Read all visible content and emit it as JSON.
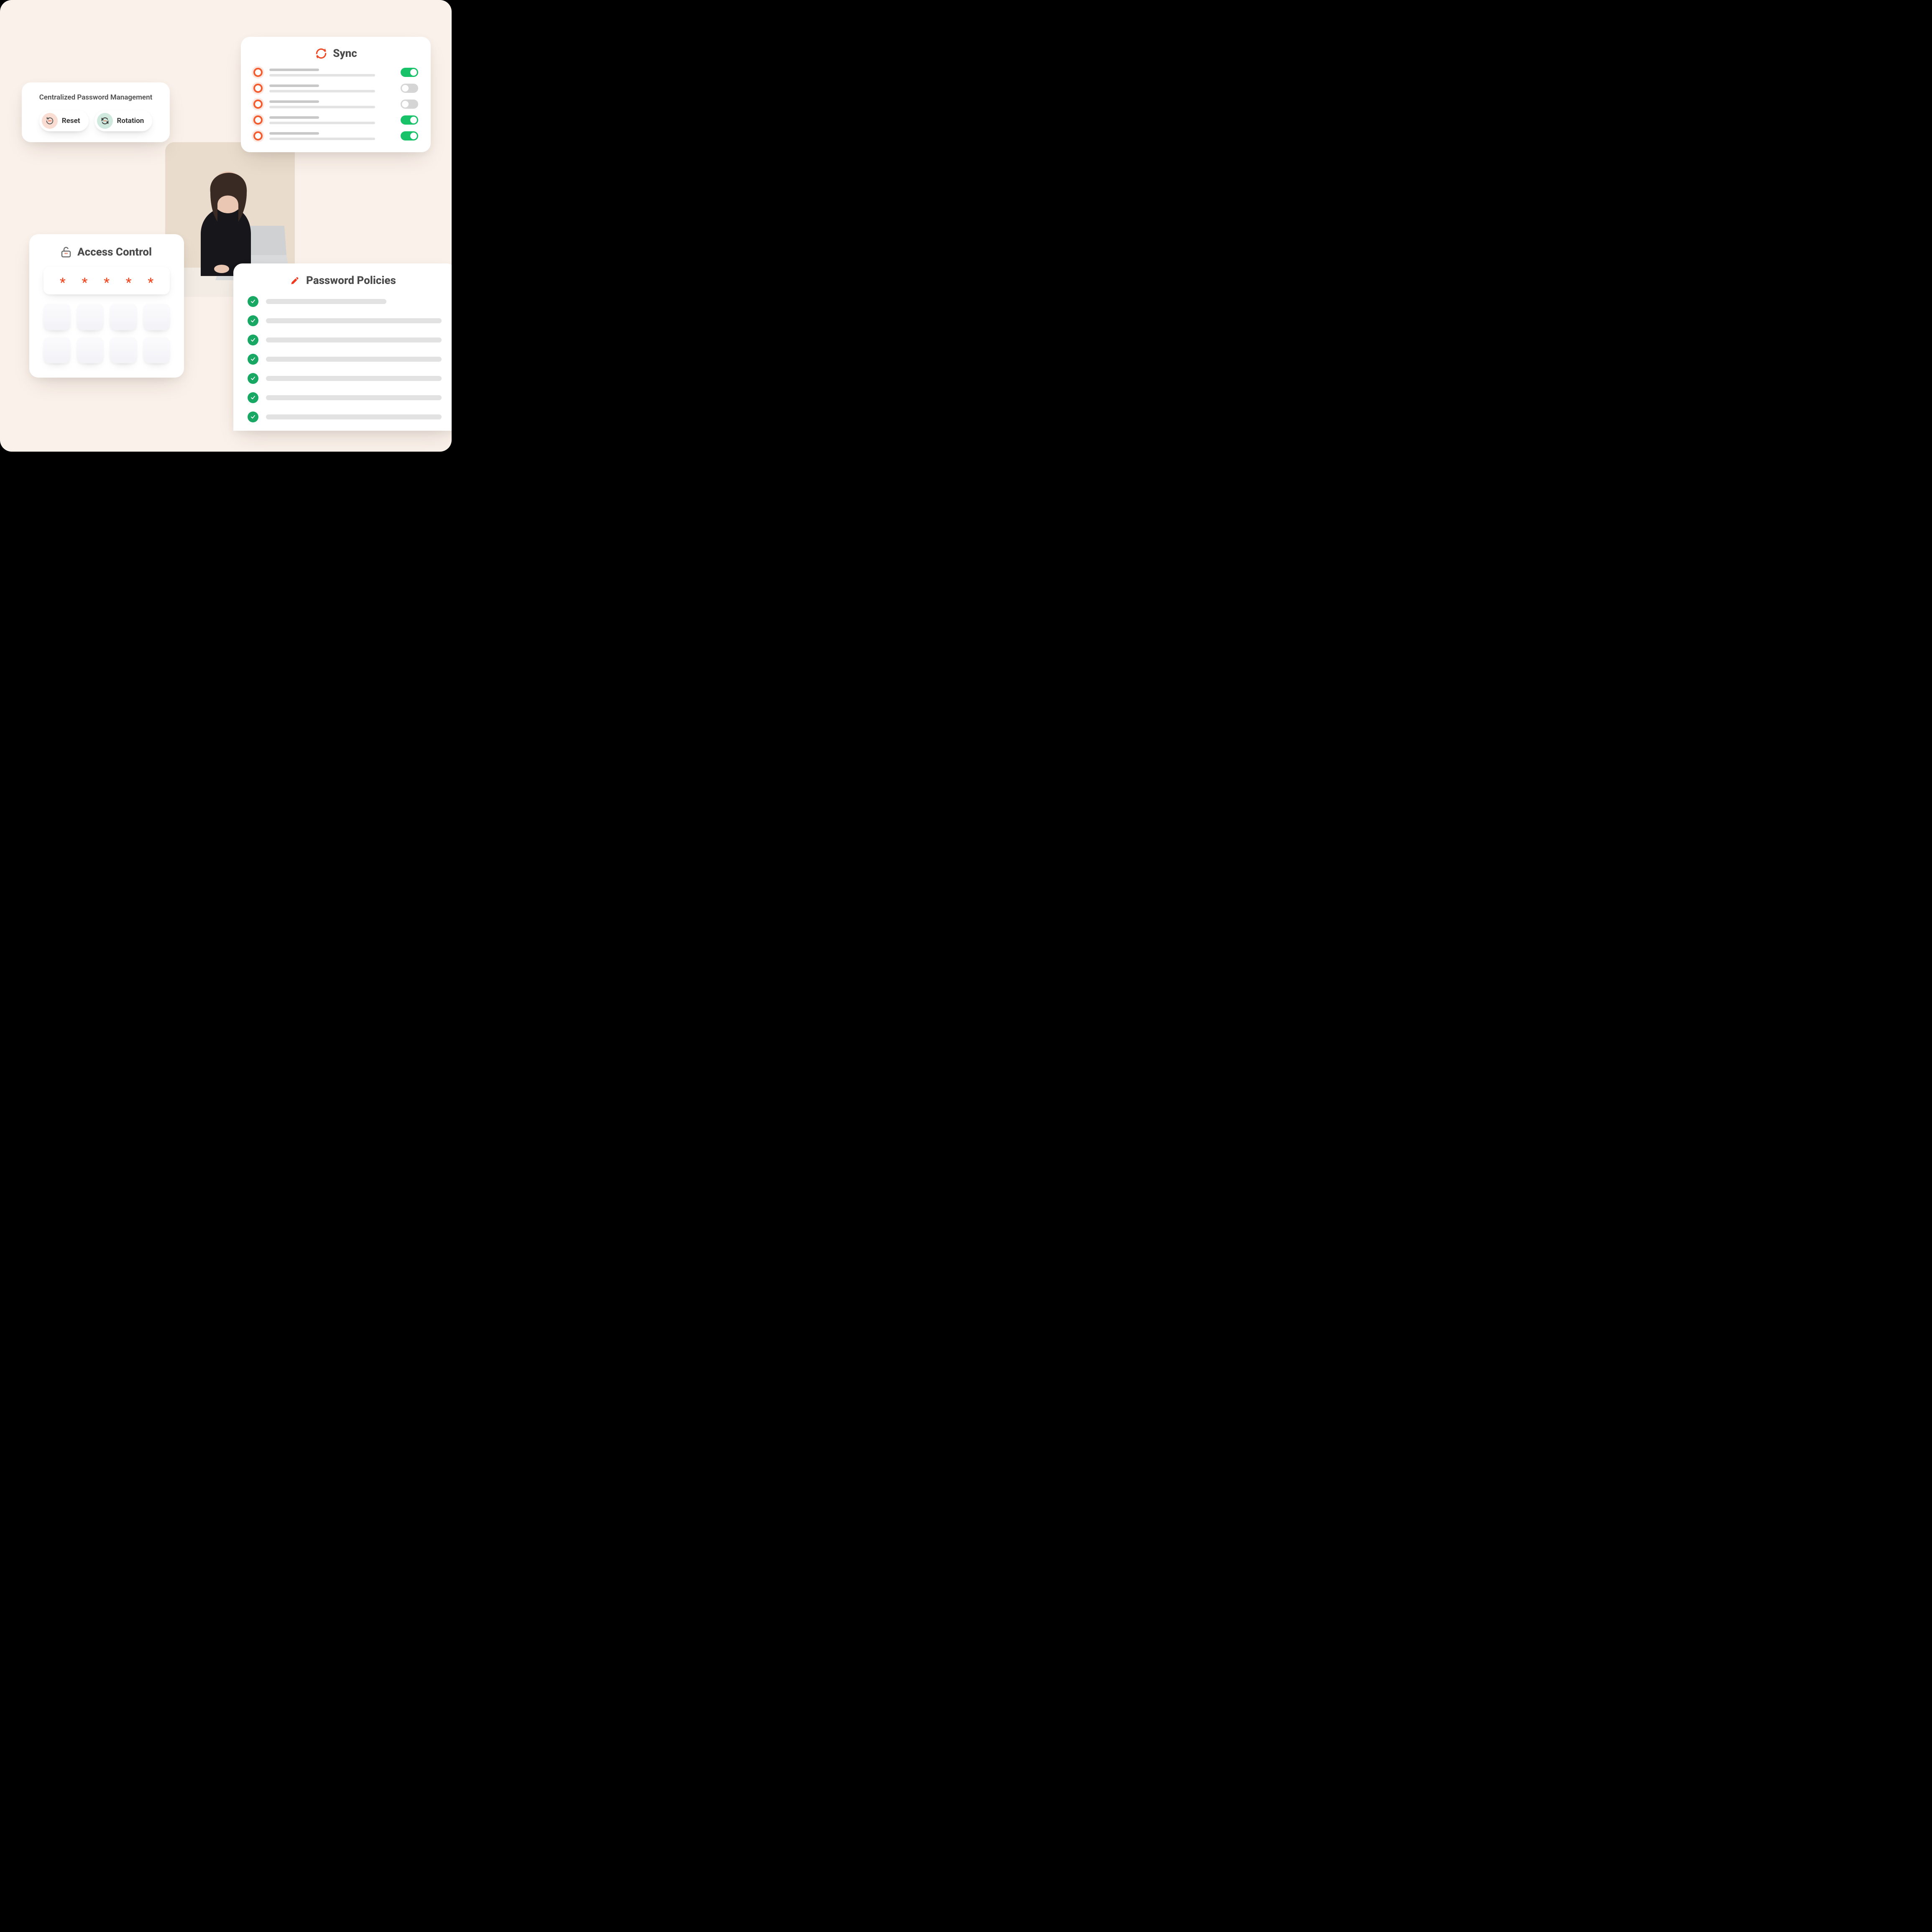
{
  "cpm": {
    "title": "Centralized Password Management",
    "reset_label": "Reset",
    "rotation_label": "Rotation"
  },
  "sync": {
    "title": "Sync",
    "items": [
      {
        "enabled": true
      },
      {
        "enabled": false
      },
      {
        "enabled": false
      },
      {
        "enabled": true
      },
      {
        "enabled": true
      }
    ]
  },
  "access": {
    "title": "Access Control",
    "pin_length": 5,
    "tile_count": 8
  },
  "policies": {
    "title": "Password Policies",
    "items": [
      {
        "checked": true,
        "width": 62
      },
      {
        "checked": true,
        "width": 95
      },
      {
        "checked": true,
        "width": 95
      },
      {
        "checked": true,
        "width": 95
      },
      {
        "checked": true,
        "width": 95
      },
      {
        "checked": true,
        "width": 95
      },
      {
        "checked": true,
        "width": 95
      }
    ]
  },
  "colors": {
    "accent": "#f25c2e",
    "success": "#18c268"
  }
}
